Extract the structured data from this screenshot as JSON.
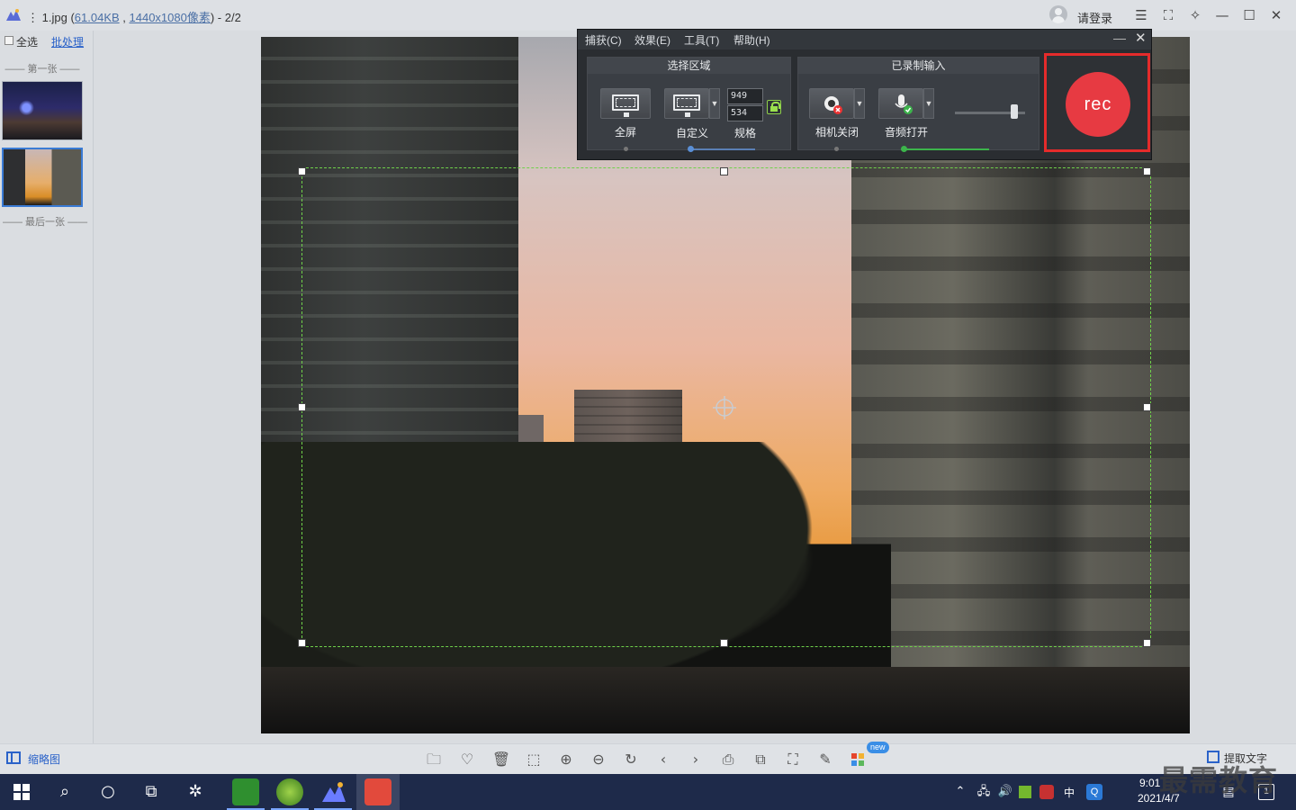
{
  "window": {
    "file_name": "1.jpg",
    "file_size": "61.04KB",
    "file_dims": "1440x1080像素",
    "title_sep": " (",
    "title_comma": " , ",
    "title_close": ")",
    "page_counter": " - 2/2",
    "prefix": "⋮",
    "login_label": "请登录"
  },
  "sidebar": {
    "select_all": "全选",
    "batch": "批处理",
    "first_label": "—— 第一张 ——",
    "last_label": "—— 最后一张 ——"
  },
  "capture": {
    "menus": [
      "捕获(C)",
      "效果(E)",
      "工具(T)",
      "帮助(H)"
    ],
    "region_title": "选择区域",
    "fullscreen_label": "全屏",
    "custom_label": "自定义",
    "spec_label": "规格",
    "width_value": "949",
    "height_value": "534",
    "input_title": "已录制输入",
    "camera_label": "相机关闭",
    "audio_label": "音频打开",
    "rec_label": "rec",
    "audio_level": 0.85,
    "colors": {
      "rec": "#e73a42",
      "rec_frame": "#e52b2b",
      "selection": "#6fd14a"
    }
  },
  "toolbar": {
    "thumbnails_label": "缩略图",
    "new_badge": "new",
    "ocr_label": "提取文字"
  },
  "taskbar": {
    "ime": "中",
    "time": "9:01",
    "date": "2021/4/7",
    "notif_count": "1"
  },
  "watermark": "最需教育"
}
